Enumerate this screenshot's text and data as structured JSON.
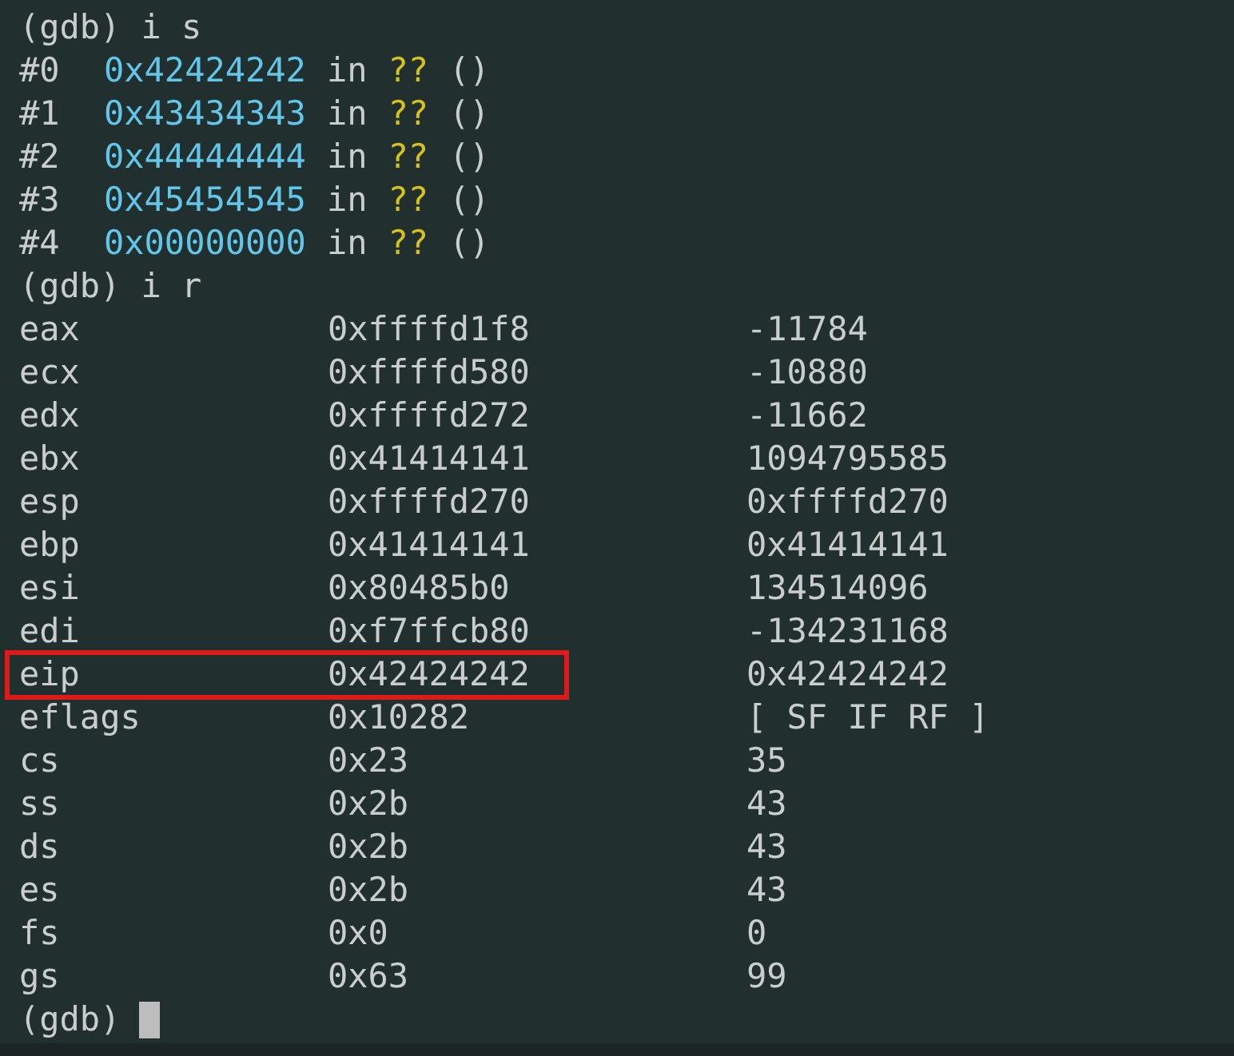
{
  "lines": [
    {
      "kind": "prompt",
      "prompt": "(gdb)",
      "command": "i s"
    },
    {
      "kind": "frame",
      "number": "#0",
      "address": "0x42424242",
      "in": "in",
      "function": "??",
      "args": "()"
    },
    {
      "kind": "frame",
      "number": "#1",
      "address": "0x43434343",
      "in": "in",
      "function": "??",
      "args": "()"
    },
    {
      "kind": "frame",
      "number": "#2",
      "address": "0x44444444",
      "in": "in",
      "function": "??",
      "args": "()"
    },
    {
      "kind": "frame",
      "number": "#3",
      "address": "0x45454545",
      "in": "in",
      "function": "??",
      "args": "()"
    },
    {
      "kind": "frame",
      "number": "#4",
      "address": "0x00000000",
      "in": "in",
      "function": "??",
      "args": "()"
    },
    {
      "kind": "prompt",
      "prompt": "(gdb)",
      "command": "i r"
    },
    {
      "kind": "register",
      "name": "eax",
      "hex": "0xffffd1f8",
      "value": "-11784",
      "highlighted": false
    },
    {
      "kind": "register",
      "name": "ecx",
      "hex": "0xffffd580",
      "value": "-10880",
      "highlighted": false
    },
    {
      "kind": "register",
      "name": "edx",
      "hex": "0xffffd272",
      "value": "-11662",
      "highlighted": false
    },
    {
      "kind": "register",
      "name": "ebx",
      "hex": "0x41414141",
      "value": "1094795585",
      "highlighted": false
    },
    {
      "kind": "register",
      "name": "esp",
      "hex": "0xffffd270",
      "value": "0xffffd270",
      "highlighted": false
    },
    {
      "kind": "register",
      "name": "ebp",
      "hex": "0x41414141",
      "value": "0x41414141",
      "highlighted": false
    },
    {
      "kind": "register",
      "name": "esi",
      "hex": "0x80485b0",
      "value": "134514096",
      "highlighted": false
    },
    {
      "kind": "register",
      "name": "edi",
      "hex": "0xf7ffcb80",
      "value": "-134231168",
      "highlighted": false
    },
    {
      "kind": "register",
      "name": "eip",
      "hex": "0x42424242",
      "value": "0x42424242",
      "highlighted": true
    },
    {
      "kind": "register",
      "name": "eflags",
      "hex": "0x10282",
      "value": "[ SF IF RF ]",
      "highlighted": false
    },
    {
      "kind": "register",
      "name": "cs",
      "hex": "0x23",
      "value": "35",
      "highlighted": false
    },
    {
      "kind": "register",
      "name": "ss",
      "hex": "0x2b",
      "value": "43",
      "highlighted": false
    },
    {
      "kind": "register",
      "name": "ds",
      "hex": "0x2b",
      "value": "43",
      "highlighted": false
    },
    {
      "kind": "register",
      "name": "es",
      "hex": "0x2b",
      "value": "43",
      "highlighted": false
    },
    {
      "kind": "register",
      "name": "fs",
      "hex": "0x0",
      "value": "0",
      "highlighted": false
    },
    {
      "kind": "register",
      "name": "gs",
      "hex": "0x63",
      "value": "99",
      "highlighted": false
    },
    {
      "kind": "prompt",
      "prompt": "(gdb)",
      "cursor": true
    }
  ]
}
